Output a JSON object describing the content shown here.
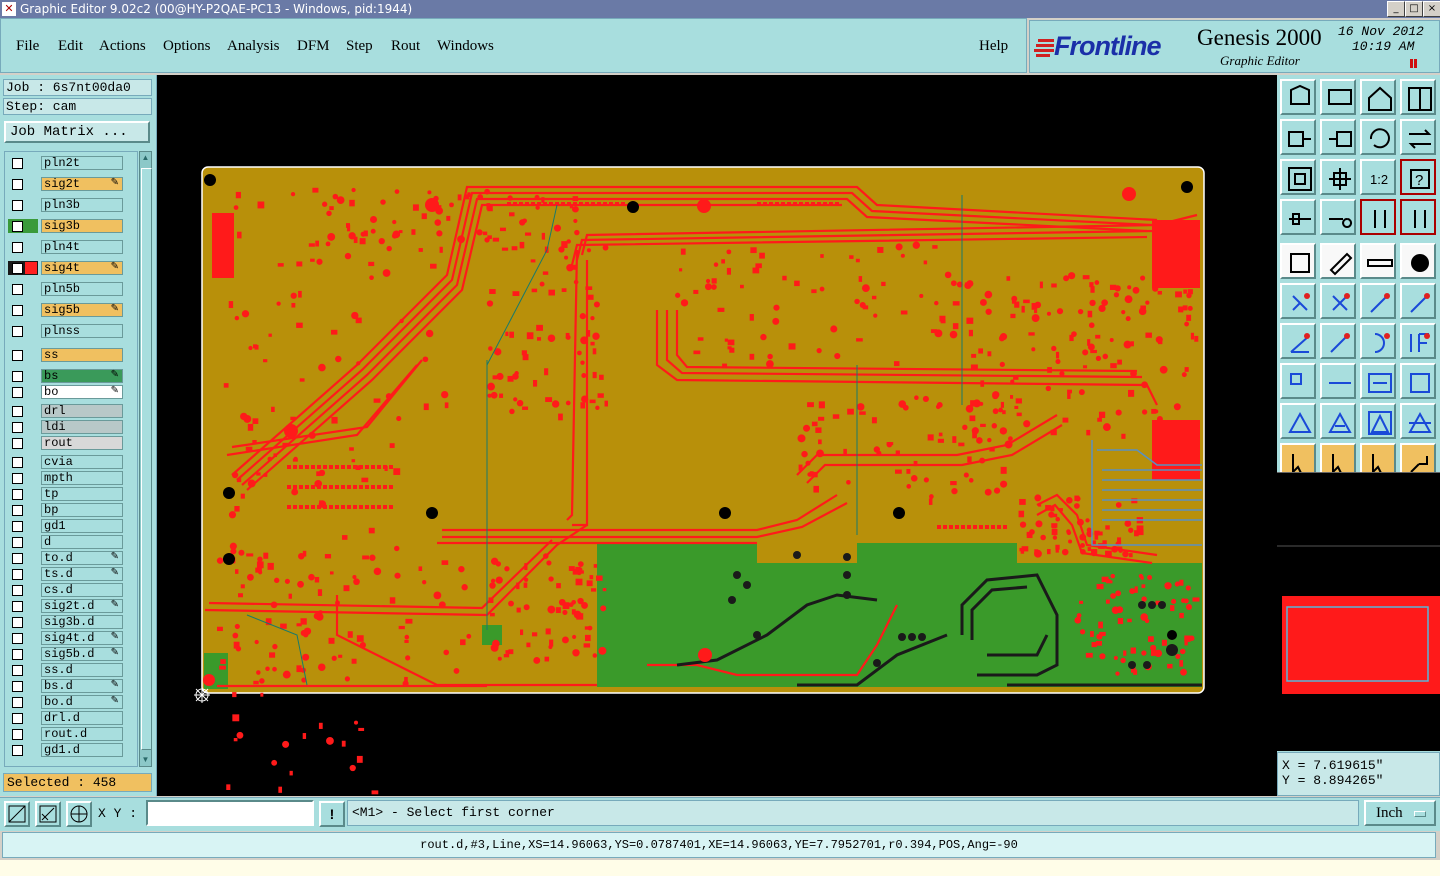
{
  "window": {
    "title": "Graphic Editor 9.02c2 (00@HY-P2QAE-PC13 - Windows, pid:1944)",
    "app_icon": "x-icon",
    "controls": [
      "_",
      "□",
      "×"
    ]
  },
  "menu": {
    "items": [
      "File",
      "Edit",
      "Actions",
      "Options",
      "Analysis",
      "DFM",
      "Step",
      "Rout",
      "Windows"
    ],
    "help": "Help"
  },
  "brand": {
    "logo": "Frontline",
    "product": "Genesis 2000",
    "subtitle": "Graphic Editor",
    "date": "16 Nov 2012",
    "time": "10:19 AM"
  },
  "job": {
    "job_line": "Job : 6s7nt00da0",
    "step_line": "Step: cam",
    "matrix_button": "Job Matrix ..."
  },
  "layers": [
    {
      "name": "pln2t",
      "color": "#a8dede",
      "editable": false
    },
    {
      "name": "sig2t",
      "color": "#f0c060",
      "editable": true
    },
    {
      "name": "pln3b",
      "color": "#a8dede",
      "editable": false
    },
    {
      "name": "sig3b",
      "color": "#f0c060",
      "editable": false,
      "swatch": "#3a9a3a"
    },
    {
      "name": "pln4t",
      "color": "#a8dede",
      "editable": false
    },
    {
      "name": "sig4t",
      "color": "#f0c060",
      "editable": true,
      "swatch": "#ff2020",
      "work": true
    },
    {
      "name": "pln5b",
      "color": "#a8dede",
      "editable": false
    },
    {
      "name": "sig5b",
      "color": "#f0c060",
      "editable": true
    },
    {
      "name": "plnss",
      "color": "#a8dede",
      "editable": false
    },
    {
      "name": "ss",
      "color": "#f0c060",
      "editable": false
    },
    {
      "name": "bs",
      "color": "#3a9a5a",
      "editable": true
    },
    {
      "name": "bo",
      "color": "#ffffff",
      "editable": true
    },
    {
      "name": "drl",
      "color": "#b8c8c8",
      "editable": false
    },
    {
      "name": "ldi",
      "color": "#b8c8c8",
      "editable": false
    },
    {
      "name": "rout",
      "color": "#d8d8d8",
      "editable": false
    },
    {
      "name": "cvia",
      "color": "#a8dede",
      "editable": false
    },
    {
      "name": "mpth",
      "color": "#a8dede",
      "editable": false
    },
    {
      "name": "tp",
      "color": "#a8dede",
      "editable": false
    },
    {
      "name": "bp",
      "color": "#a8dede",
      "editable": false
    },
    {
      "name": "gd1",
      "color": "#a8dede",
      "editable": false
    },
    {
      "name": "d",
      "color": "#a8dede",
      "editable": false
    },
    {
      "name": "to.d",
      "color": "#a8dede",
      "editable": true
    },
    {
      "name": "ts.d",
      "color": "#a8dede",
      "editable": true
    },
    {
      "name": "cs.d",
      "color": "#a8dede",
      "editable": false
    },
    {
      "name": "sig2t.d",
      "color": "#a8dede",
      "editable": true
    },
    {
      "name": "sig3b.d",
      "color": "#a8dede",
      "editable": false
    },
    {
      "name": "sig4t.d",
      "color": "#a8dede",
      "editable": true
    },
    {
      "name": "sig5b.d",
      "color": "#a8dede",
      "editable": true
    },
    {
      "name": "ss.d",
      "color": "#a8dede",
      "editable": false
    },
    {
      "name": "bs.d",
      "color": "#a8dede",
      "editable": true
    },
    {
      "name": "bo.d",
      "color": "#a8dede",
      "editable": true
    },
    {
      "name": "drl.d",
      "color": "#a8dede",
      "editable": false
    },
    {
      "name": "rout.d",
      "color": "#a8dede",
      "editable": false
    },
    {
      "name": "gd1.d",
      "color": "#a8dede",
      "editable": false
    }
  ],
  "selection": {
    "text": "Selected : 458"
  },
  "coordinates": {
    "x": "X = 7.619615\"",
    "y": "Y = 8.894265\""
  },
  "input": {
    "xy_label": "X Y :",
    "xy_value": "",
    "info_button": "!"
  },
  "prompt": {
    "text": "<M1> - Select first corner"
  },
  "units": {
    "value": "Inch"
  },
  "status": {
    "text": "rout.d,#3,Line,XS=14.96063,YS=0.0787401,XE=14.96063,YE=7.7952701,r0.394,POS,Ang=-90"
  },
  "tools": [
    "zoom-home-icon",
    "zoom-fit-icon",
    "home-icon",
    "split-view-icon",
    "pan-left-icon",
    "pan-right-icon",
    "undo-view-icon",
    "redraw-icon",
    "zoom-window-icon",
    "zoom-center-icon",
    "scale-1-2-icon",
    "help-icon",
    "measure-icon",
    "snap-icon",
    "layer-up-icon",
    "layer-down-icon",
    "pad-icon",
    "line-icon",
    "ruler-icon",
    "dot-icon",
    "connect-icon",
    "cross-icon",
    "add-pad-icon",
    "move-pad-icon",
    "draw-line-icon",
    "diagonal-icon",
    "arc-icon",
    "flip-icon",
    "surface-icon",
    "line-tool-icon",
    "resize-icon",
    "group-icon",
    "triangle-icon",
    "text-a-icon",
    "text-a-frame-icon",
    "text-a-cross-icon",
    "select-pointer-icon",
    "select-single-icon",
    "select-edit-icon",
    "select-route-icon"
  ],
  "colors": {
    "panel": "#a8dede",
    "board": "#b8900a",
    "trace": "#ff1a1a",
    "ground_plane": "#3a9a2a",
    "highlight_layer": "#f0c060"
  }
}
